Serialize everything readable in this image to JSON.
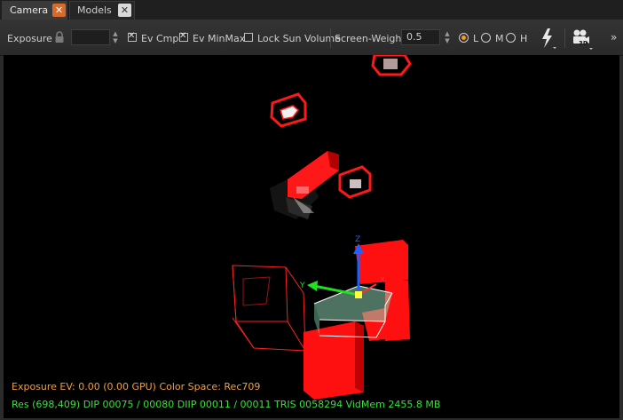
{
  "tabs": [
    {
      "label": "Camera",
      "close": "✕"
    },
    {
      "label": "Models",
      "close": "✕"
    }
  ],
  "toolbar": {
    "exposure_label": "Exposure",
    "exposure_value": "",
    "ev_cmp": {
      "label": "Ev Cmp",
      "checked": true
    },
    "ev_minmax": {
      "label": "Ev MinMax",
      "checked": true
    },
    "lock_sun": {
      "label": "Lock Sun Volume",
      "checked": false
    },
    "screen_weight_label": "Screen-Weight",
    "screen_weight_value": "0.5",
    "lod": {
      "options": [
        "L",
        "M",
        "H"
      ],
      "selected": "L"
    },
    "view_badge": "3D",
    "overflow": "»"
  },
  "viewport": {
    "axis_labels": {
      "x": "X",
      "y": "Y",
      "z": "Z"
    },
    "hud_line1": "Exposure EV: 0.00 (0.00 GPU)  Color Space: Rec709",
    "hud_line2": "Res (698,409)   DIP 00075 / 00080  DIIP 00011 / 00011  TRIS 0058294  VidMem 2455.8 MB"
  },
  "colors": {
    "accent": "#d86a2a",
    "hud_orange": "#f0a040",
    "hud_green": "#38e038",
    "object_red": "#ff1010",
    "viewport_bg": "#000000"
  },
  "icons": [
    "close-icon",
    "lock-icon",
    "lightning-icon",
    "camera-3d-icon",
    "overflow-chevron-icon"
  ]
}
